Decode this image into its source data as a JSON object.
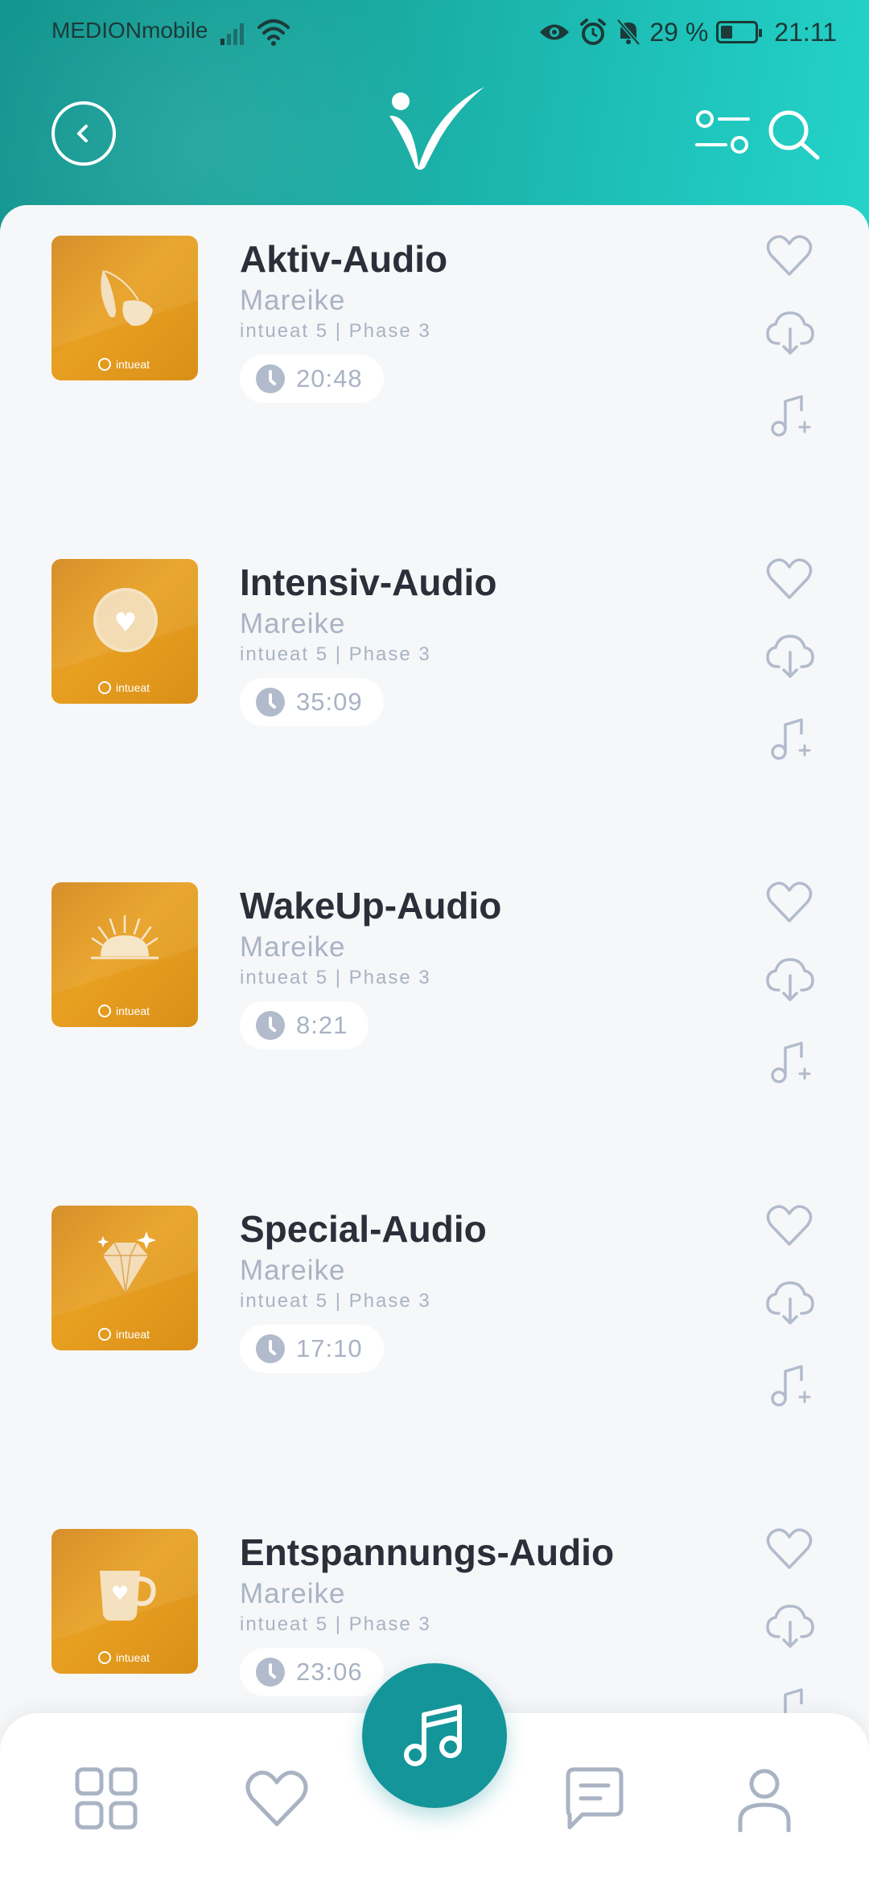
{
  "status_bar": {
    "carrier": "MEDIONmobile",
    "battery": "29 %",
    "battery_level": 0.29,
    "time": "21:11",
    "icons": [
      "signal-icon",
      "wifi-icon",
      "eye-icon",
      "alarm-icon",
      "mute-icon",
      "battery-icon"
    ]
  },
  "header": {
    "icons": [
      "back-icon",
      "intueat-logo",
      "filter-icon",
      "search-icon"
    ]
  },
  "items": [
    {
      "title": "Aktiv-Audio",
      "author": "Mareike",
      "meta": "intueat 5 | Phase 3",
      "duration": "20:48",
      "art": "leaf-art",
      "brand": "intueat"
    },
    {
      "title": "Intensiv-Audio",
      "author": "Mareike",
      "meta": "intueat 5 | Phase 3",
      "duration": "35:09",
      "art": "heart-disc-art",
      "brand": "intueat"
    },
    {
      "title": "WakeUp-Audio",
      "author": "Mareike",
      "meta": "intueat 5 | Phase 3",
      "duration": "8:21",
      "art": "sunrise-art",
      "brand": "intueat"
    },
    {
      "title": "Special-Audio",
      "author": "Mareike",
      "meta": "intueat 5 | Phase 3",
      "duration": "17:10",
      "art": "diamond-art",
      "brand": "intueat"
    },
    {
      "title": "Entspannungs-Audio",
      "author": "Mareike",
      "meta": "intueat 5 | Phase 3",
      "duration": "23:06",
      "art": "cup-art",
      "brand": "intueat"
    }
  ],
  "item_actions": [
    "heart-icon",
    "download-icon",
    "add-to-playlist-icon"
  ],
  "bottom_nav": {
    "items": [
      "grid-icon",
      "heart-icon",
      "music-icon",
      "chat-icon",
      "profile-icon"
    ],
    "active": "music-icon"
  },
  "colors": {
    "header_start": "#14958f",
    "header_end": "#24d3c9",
    "accent": "#14959a",
    "thumb": "#e19a1f",
    "title": "#2c2f3a",
    "muted": "#a9b3c3"
  }
}
